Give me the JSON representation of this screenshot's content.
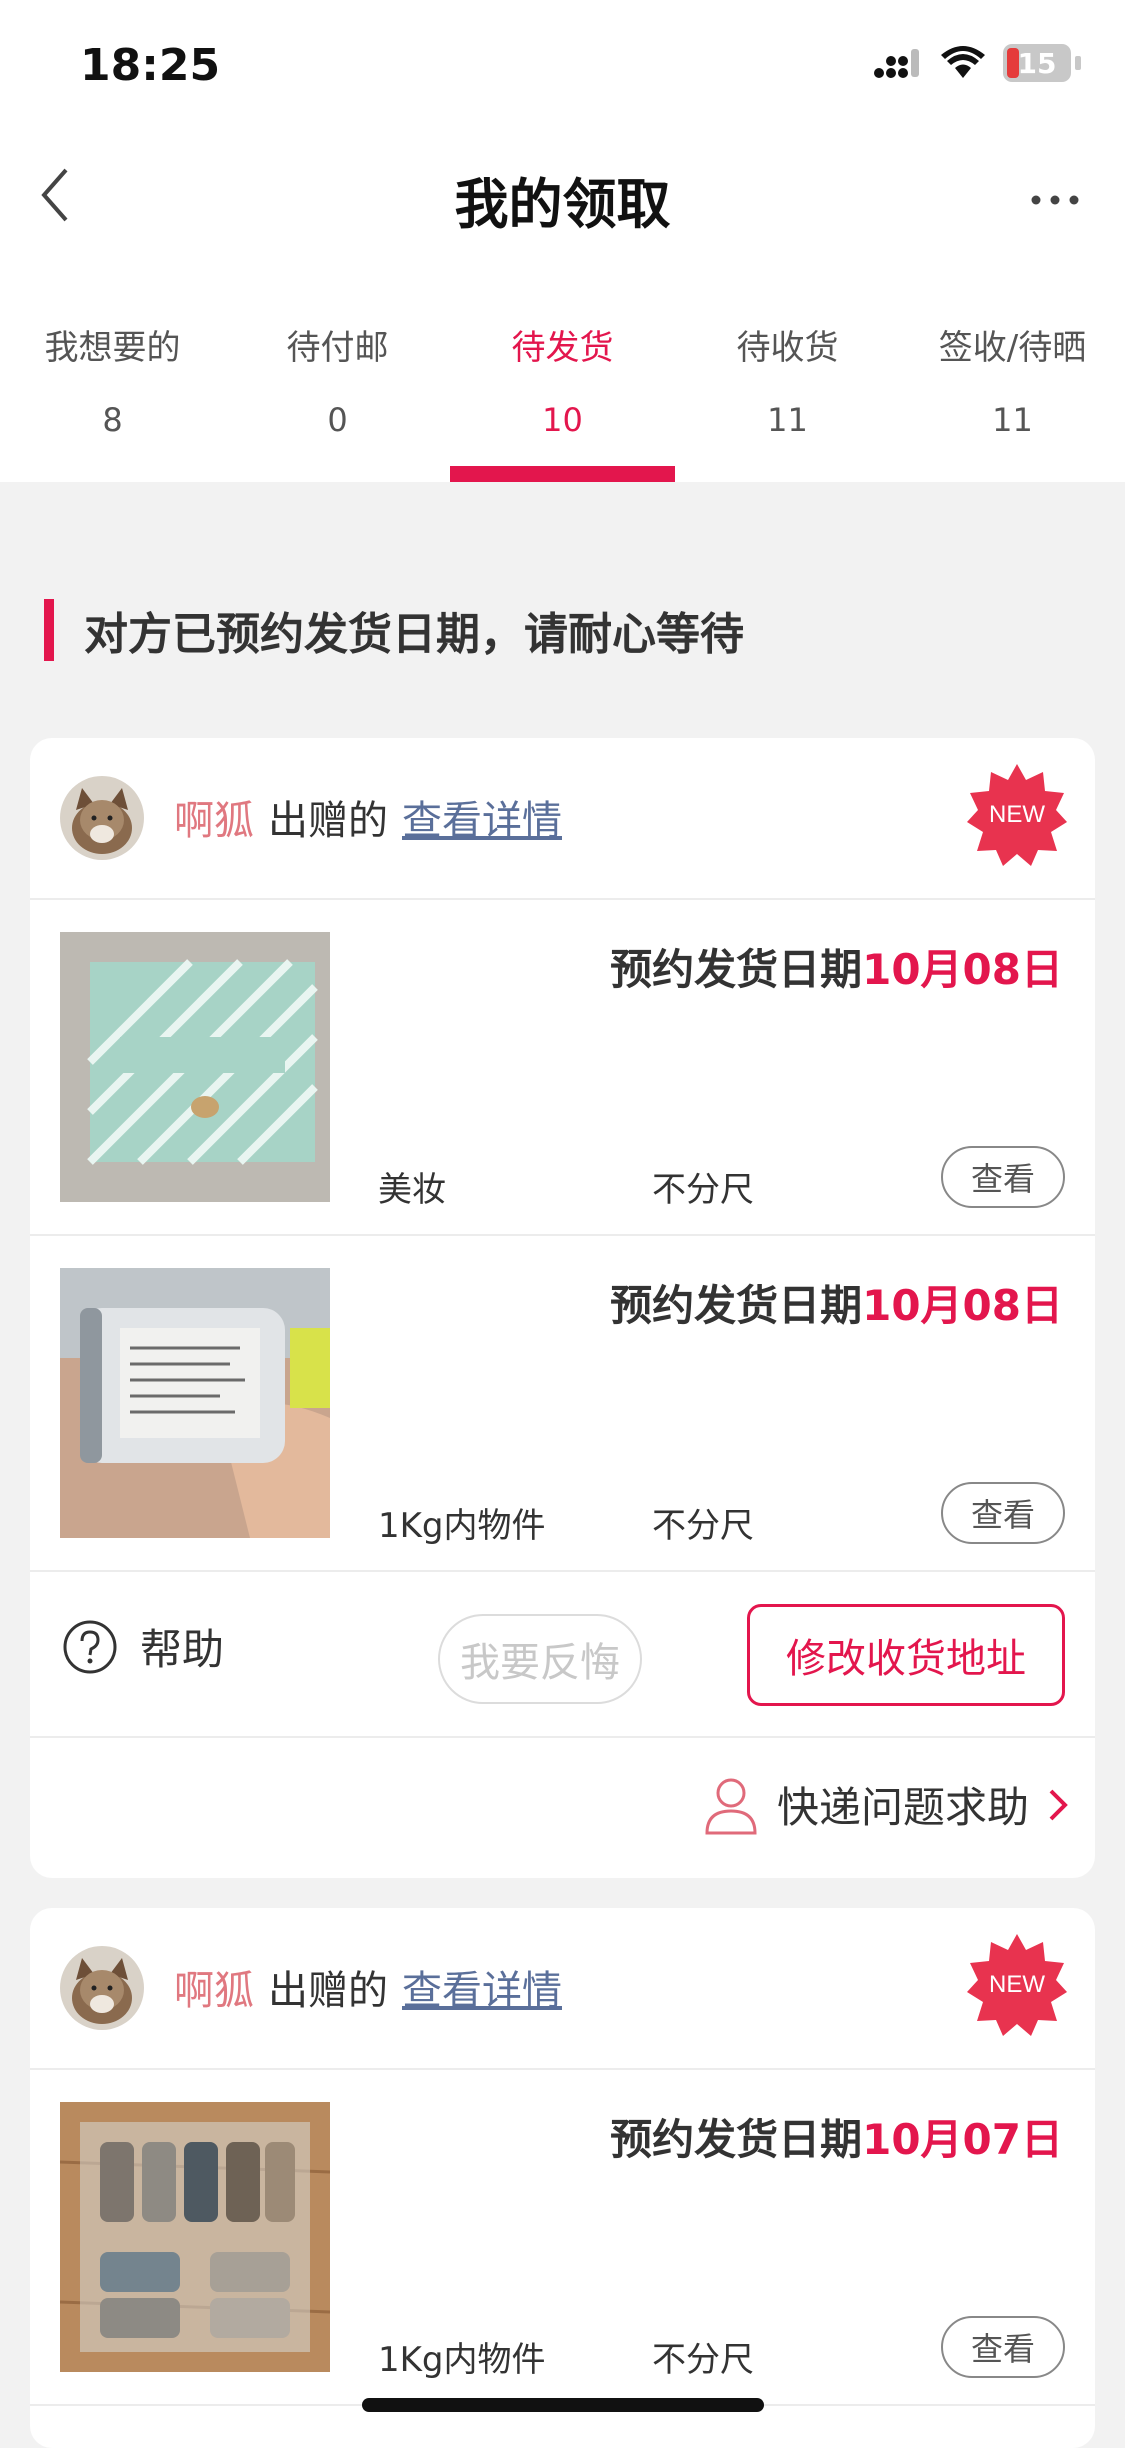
{
  "status_bar": {
    "time": "18:25",
    "battery": "15"
  },
  "header": {
    "title": "我的领取"
  },
  "tabs": [
    {
      "label": "我想要的",
      "count": "8"
    },
    {
      "label": "待付邮",
      "count": "0"
    },
    {
      "label": "待发货",
      "count": "10",
      "active": true
    },
    {
      "label": "待收货",
      "count": "11"
    },
    {
      "label": "签收/待晒",
      "count": "11"
    }
  ],
  "notice": "对方已预约发货日期，请耐心等待",
  "orders": [
    {
      "giver": "啊狐",
      "gave_text": "出赠的",
      "detail_link": "查看详情",
      "badge": "NEW",
      "items": [
        {
          "ship_prefix": "预约发货日期",
          "ship_date": "10月08日",
          "category": "美妆",
          "size": "不分尺",
          "view": "查看"
        },
        {
          "ship_prefix": "预约发货日期",
          "ship_date": "10月08日",
          "category": "1Kg内物件",
          "size": "不分尺",
          "view": "查看"
        }
      ],
      "help": "帮助",
      "regret": "我要反悔",
      "change_address": "修改收货地址",
      "express_help": "快递问题求助"
    },
    {
      "giver": "啊狐",
      "gave_text": "出赠的",
      "detail_link": "查看详情",
      "badge": "NEW",
      "items": [
        {
          "ship_prefix": "预约发货日期",
          "ship_date": "10月07日",
          "category": "1Kg内物件",
          "size": "不分尺",
          "view": "查看"
        }
      ]
    }
  ],
  "colors": {
    "accent": "#e3164d",
    "giver": "#e07880",
    "link": "#5a6f9a"
  }
}
